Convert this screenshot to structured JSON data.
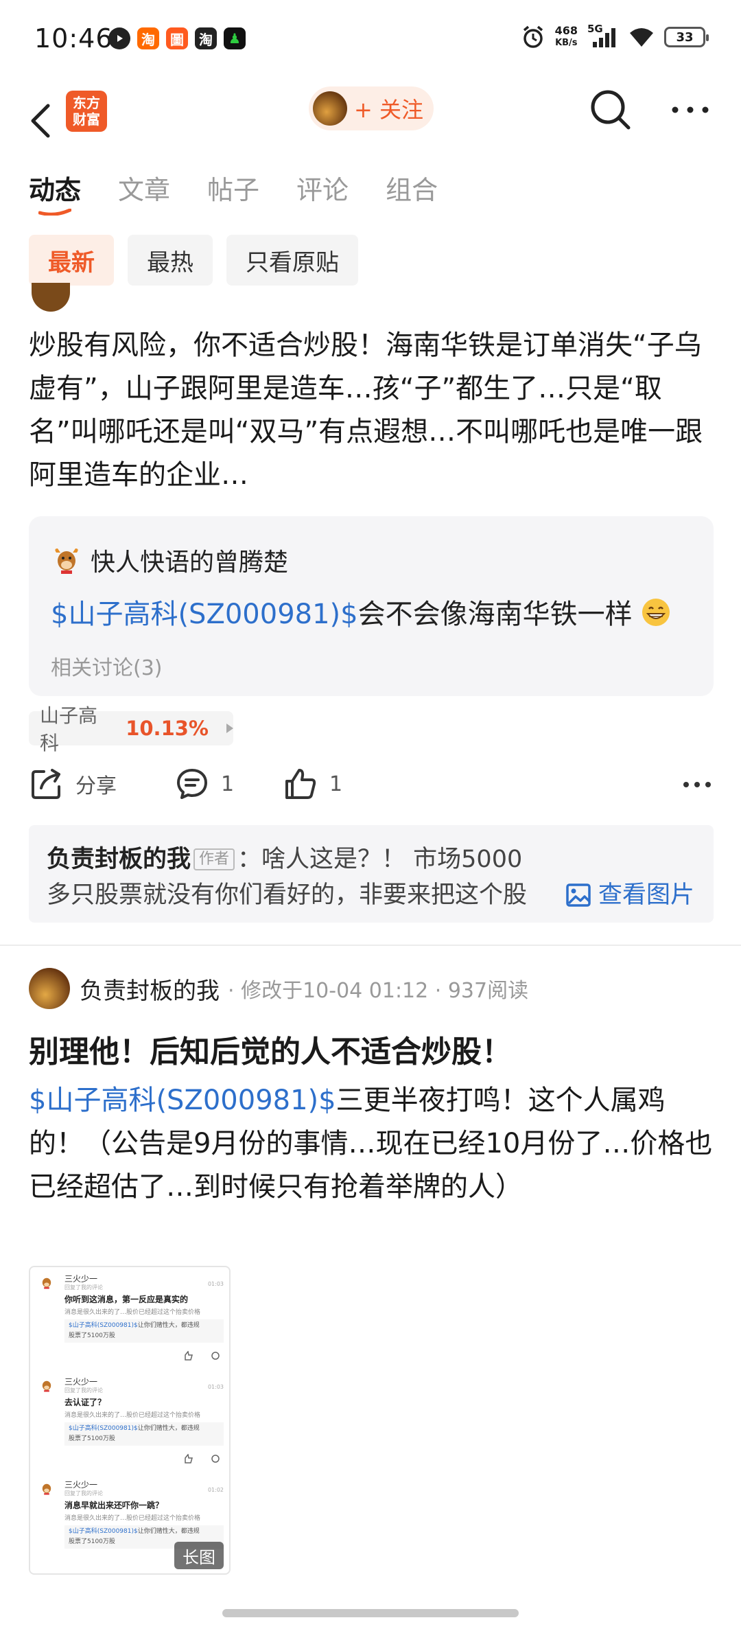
{
  "status_bar": {
    "time": "10:46",
    "app_icons": [
      {
        "name": "taobao-icon",
        "glyph": "淘",
        "color": "#ff6a00"
      },
      {
        "name": "app2-icon",
        "glyph": "圖",
        "color": "#ff5a1f"
      },
      {
        "name": "taobao-alt-icon",
        "glyph": "淘",
        "color": "#222222"
      },
      {
        "name": "app4-icon",
        "glyph": "♟",
        "color": "#111111"
      }
    ],
    "net_speed_value": "468",
    "net_speed_unit": "KB/s",
    "network": "5G",
    "battery": "33"
  },
  "header": {
    "logo_line1": "东方",
    "logo_line2": "财富",
    "follow_label": "+ 关注"
  },
  "tabs": [
    "动态",
    "文章",
    "帖子",
    "评论",
    "组合"
  ],
  "filters": [
    "最新",
    "最热",
    "只看原贴"
  ],
  "post1": {
    "text": "炒股有风险，你不适合炒股！海南华铁是订单消失“子乌虚有”，山子跟阿里是造车…孩“子”都生了…只是“取名”叫哪吒还是叫“双马”有点遐想…不叫哪吒也是唯一跟阿里造车的企业…",
    "quote": {
      "author": "快人快语的曾腾楚",
      "stock_link": "$山子高科(SZ000981)$",
      "body": "会不会像海南华铁一样",
      "related": "相关讨论(3)"
    },
    "stock_chip": {
      "name": "山子高科",
      "change": "10.13%"
    },
    "actions": {
      "share": "分享",
      "comments": "1",
      "likes": "1"
    },
    "reply": {
      "name": "负责封板的我",
      "tag": "作者",
      "line1": "：啥人这是？！ 市场5000",
      "line2": "多只股票就没有你们看好的，非要来把这个股",
      "view_image": "查看图片"
    }
  },
  "post2": {
    "author": "负责封板的我",
    "meta": "· 修改于10-04 01:12 · 937阅读",
    "title": "别理他！后知后觉的人不适合炒股！",
    "stock_link": "$山子高科(SZ000981)$",
    "text": "三更半夜打鸣！这个人属鸡的！（公告是9月份的事情…现在已经10月份了…价格也已经超估了…到时候只有抢着举牌的人）",
    "thumbnail": {
      "long_label": "长图",
      "messages": [
        {
          "name": "三火少一",
          "sub": "回复了我的评论",
          "time": "01:03",
          "question": "你听到这消息，第一反应是真实的",
          "context": "消息是很久出来的了…股价已经超过这个抬卖价格",
          "link": "$山子高科(SZ000981)$",
          "quote_rest": "让你们赌性大，都违规",
          "quote_line2": "股票了5100万股"
        },
        {
          "name": "三火少一",
          "sub": "回复了我的评论",
          "time": "01:03",
          "question": "去认证了？",
          "context": "消息是很久出来的了…股价已经超过这个抬卖价格",
          "link": "$山子高科(SZ000981)$",
          "quote_rest": "让你们赌性大，都违规",
          "quote_line2": "股票了5100万股"
        },
        {
          "name": "三火少一",
          "sub": "回复了我的评论",
          "time": "01:02",
          "question": "消息早就出来还吓你一跳？",
          "context": "消息是很久出来的了…股价已经超过这个抬卖价格",
          "link": "$山子高科(SZ000981)$",
          "quote_rest": "让你们赌性大，都违规",
          "quote_line2": "股票了5100万股"
        }
      ]
    }
  },
  "colors": {
    "accent": "#ef5a28",
    "link": "#2d6fcb",
    "gain": "#e8542a"
  }
}
